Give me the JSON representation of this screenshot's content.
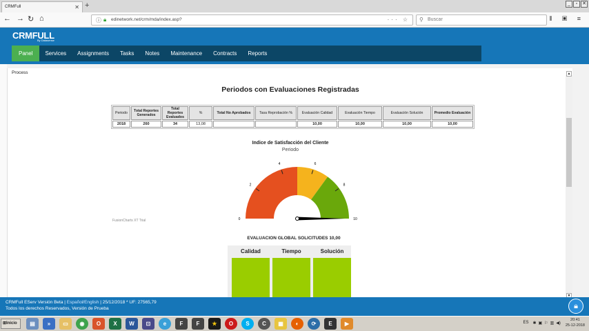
{
  "browser": {
    "tab_title": "CRMFull",
    "url": "edinetwork.net/crm/mda/index.asp?",
    "search_placeholder": "Buscar"
  },
  "app": {
    "logo": "CRMFULL",
    "logo_sub": "By Datasense",
    "menu": [
      "Panel",
      "Services",
      "Assignments",
      "Tasks",
      "Notes",
      "Maintenance",
      "Contracts",
      "Reports"
    ]
  },
  "page": {
    "section": "Process",
    "title": "Periodos con Evaluaciones Registradas",
    "table": {
      "headers": [
        "Periodo",
        "Total Reportes Generados",
        "Total Reportes Evaluados",
        "%",
        "Total No Aprobados",
        "Tasa Reprobación %",
        "Evaluación Calidad",
        "Evaluación Tiempo",
        "Evaluación Solución",
        "Promedio Evaluación"
      ],
      "row": [
        "2018",
        "260",
        "34",
        "13,08",
        "",
        "",
        "10,00",
        "10,00",
        "10,00",
        "10,00"
      ]
    },
    "gauge": {
      "title": "Indice de Satisfacción del Cliente",
      "subtitle": "Periodo",
      "value": 10,
      "min": 0,
      "max": 10,
      "tick_labels": [
        "0",
        "2",
        "4",
        "6",
        "8",
        "10"
      ],
      "bands": [
        {
          "from": 0,
          "to": 5,
          "color": "#e5501f"
        },
        {
          "from": 5,
          "to": 7,
          "color": "#f5b31d"
        },
        {
          "from": 7,
          "to": 10,
          "color": "#6aa80b"
        }
      ],
      "watermark": "FusionCharts XT Trial"
    },
    "evaluation": {
      "title": "EVALUACION GLOBAL SOLICITUDES 10,00",
      "columns": [
        "Calidad",
        "Tiempo",
        "Solución"
      ],
      "bar_color": "#9acd00"
    }
  },
  "footer": {
    "version": "CRMFull EServ Versión Beta |",
    "lang_es": "Español",
    "lang_sep": "/",
    "lang_en": "English",
    "date_info": "| 25/12/2018 * UF: 27565,79",
    "rights": "Todos los derechos Reservados, Versión de Prueba"
  },
  "taskbar": {
    "start": "Inicio",
    "lang": "ES",
    "time": "20:41",
    "date": "25-12-2018"
  }
}
